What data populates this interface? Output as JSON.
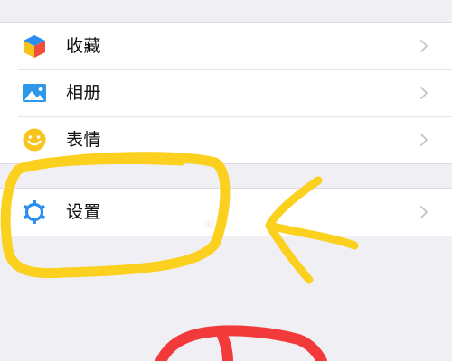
{
  "menu": {
    "items": [
      {
        "label": "收藏",
        "icon": "favorites-cube-icon"
      },
      {
        "label": "相册",
        "icon": "photo-album-icon"
      },
      {
        "label": "表情",
        "icon": "emoji-smiley-icon"
      }
    ],
    "settings": {
      "label": "设置",
      "icon": "settings-gear-icon"
    }
  },
  "watermark": "ill it.",
  "annotation_colors": {
    "circle": "#fcd01f",
    "arrow": "#fcd01f",
    "partial_mark": "#f23a3a"
  }
}
